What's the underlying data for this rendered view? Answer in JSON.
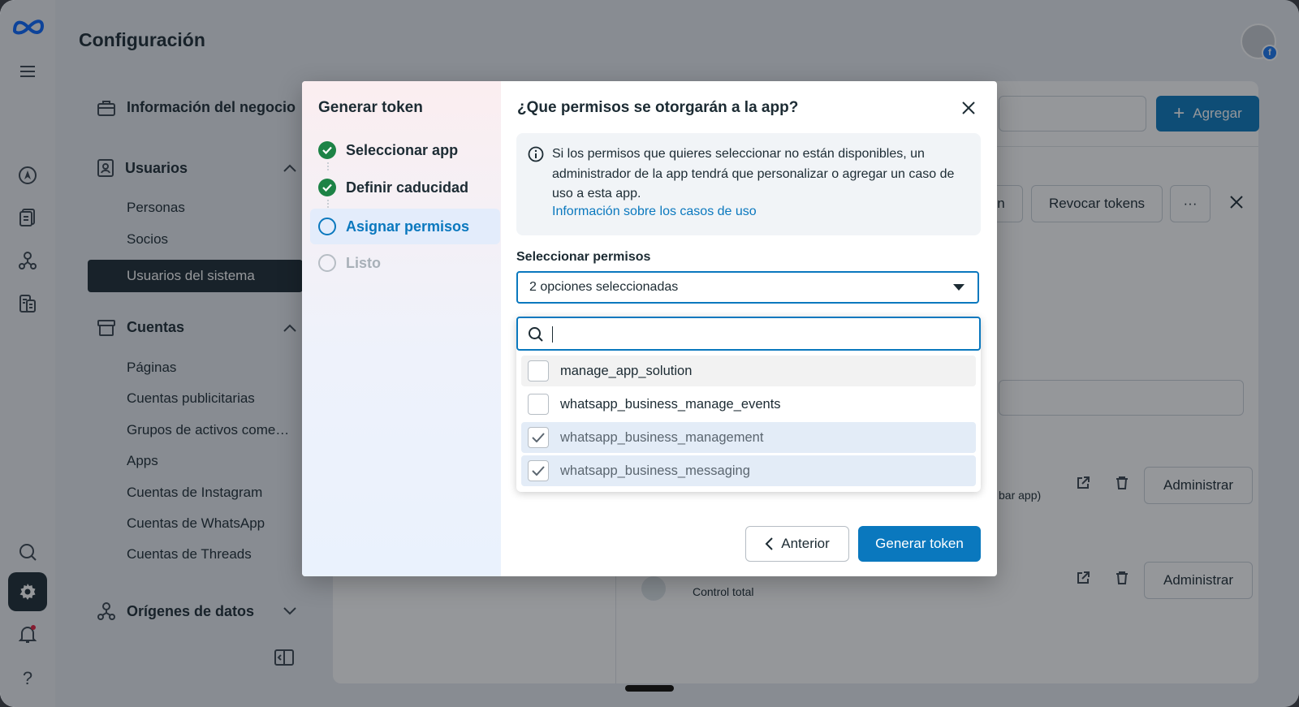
{
  "header": {
    "title": "Configuración"
  },
  "nav": {
    "business_info": "Información del negocio",
    "users": {
      "label": "Usuarios",
      "items": [
        "Personas",
        "Socios",
        "Usuarios del sistema"
      ]
    },
    "accounts": {
      "label": "Cuentas",
      "items": [
        "Páginas",
        "Cuentas publicitarias",
        "Grupos de activos come…",
        "Apps",
        "Cuentas de Instagram",
        "Cuentas de WhatsApp",
        "Cuentas de Threads"
      ]
    },
    "data_sources": {
      "label": "Orígenes de datos"
    }
  },
  "background": {
    "add_label": "Agregar",
    "revoke_label": "Revocar tokens",
    "more_label": "···",
    "partial_btn": "n",
    "manage_label": "Administrar",
    "partial_text": "bar app)",
    "control_total": "Control total"
  },
  "modal": {
    "steps_title": "Generar token",
    "steps": [
      {
        "label": "Seleccionar app",
        "state": "done"
      },
      {
        "label": "Definir caducidad",
        "state": "done"
      },
      {
        "label": "Asignar permisos",
        "state": "current"
      },
      {
        "label": "Listo",
        "state": "todo"
      }
    ],
    "title": "¿Que permisos se otorgarán a la app?",
    "info_text": "Si los permisos que quieres seleccionar no están disponibles, un administrador de la app tendrá que personalizar o agregar un caso de uso a esta app.",
    "info_link": "Información sobre los casos de uso",
    "select_label": "Seleccionar permisos",
    "select_value": "2 opciones seleccionadas",
    "search_value": "",
    "options": [
      {
        "label": "manage_app_solution",
        "checked": false
      },
      {
        "label": "whatsapp_business_manage_events",
        "checked": false
      },
      {
        "label": "whatsapp_business_management",
        "checked": true
      },
      {
        "label": "whatsapp_business_messaging",
        "checked": true
      }
    ],
    "prev_label": "Anterior",
    "generate_label": "Generar token"
  },
  "colors": {
    "primary": "#0a78be",
    "success": "#1d8346",
    "dark": "#1c2b33"
  }
}
